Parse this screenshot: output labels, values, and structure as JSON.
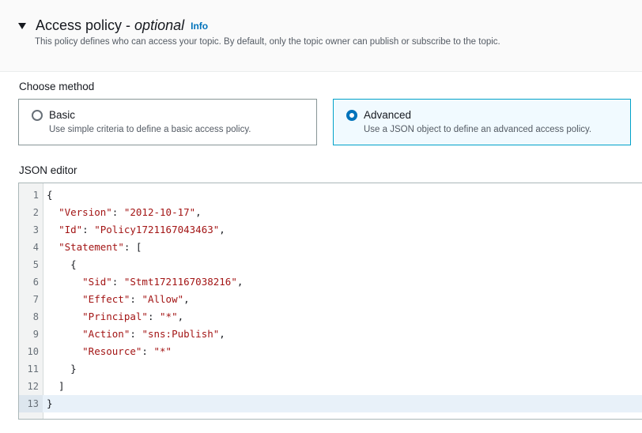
{
  "header": {
    "title": "Access policy -",
    "title_optional": "optional",
    "info_label": "Info",
    "description": "This policy defines who can access your topic. By default, only the topic owner can publish or subscribe to the topic."
  },
  "method": {
    "label": "Choose method",
    "options": [
      {
        "title": "Basic",
        "description": "Use simple criteria to define a basic access policy.",
        "selected": false
      },
      {
        "title": "Advanced",
        "description": "Use a JSON object to define an advanced access policy.",
        "selected": true
      }
    ]
  },
  "editor": {
    "label": "JSON editor",
    "active_line": 13,
    "lines": [
      {
        "num": "1",
        "text": "{"
      },
      {
        "num": "2",
        "text": "  \"Version\": \"2012-10-17\","
      },
      {
        "num": "3",
        "text": "  \"Id\": \"Policy1721167043463\","
      },
      {
        "num": "4",
        "text": "  \"Statement\": ["
      },
      {
        "num": "5",
        "text": "    {"
      },
      {
        "num": "6",
        "text": "      \"Sid\": \"Stmt1721167038216\","
      },
      {
        "num": "7",
        "text": "      \"Effect\": \"Allow\","
      },
      {
        "num": "8",
        "text": "      \"Principal\": \"*\","
      },
      {
        "num": "9",
        "text": "      \"Action\": \"sns:Publish\","
      },
      {
        "num": "10",
        "text": "      \"Resource\": \"*\""
      },
      {
        "num": "11",
        "text": "    }"
      },
      {
        "num": "12",
        "text": "  ]"
      },
      {
        "num": "13",
        "text": "}"
      }
    ]
  },
  "colors": {
    "accent": "#0073bb",
    "selected_border": "#00a1c9",
    "json_string": "#a31515"
  }
}
